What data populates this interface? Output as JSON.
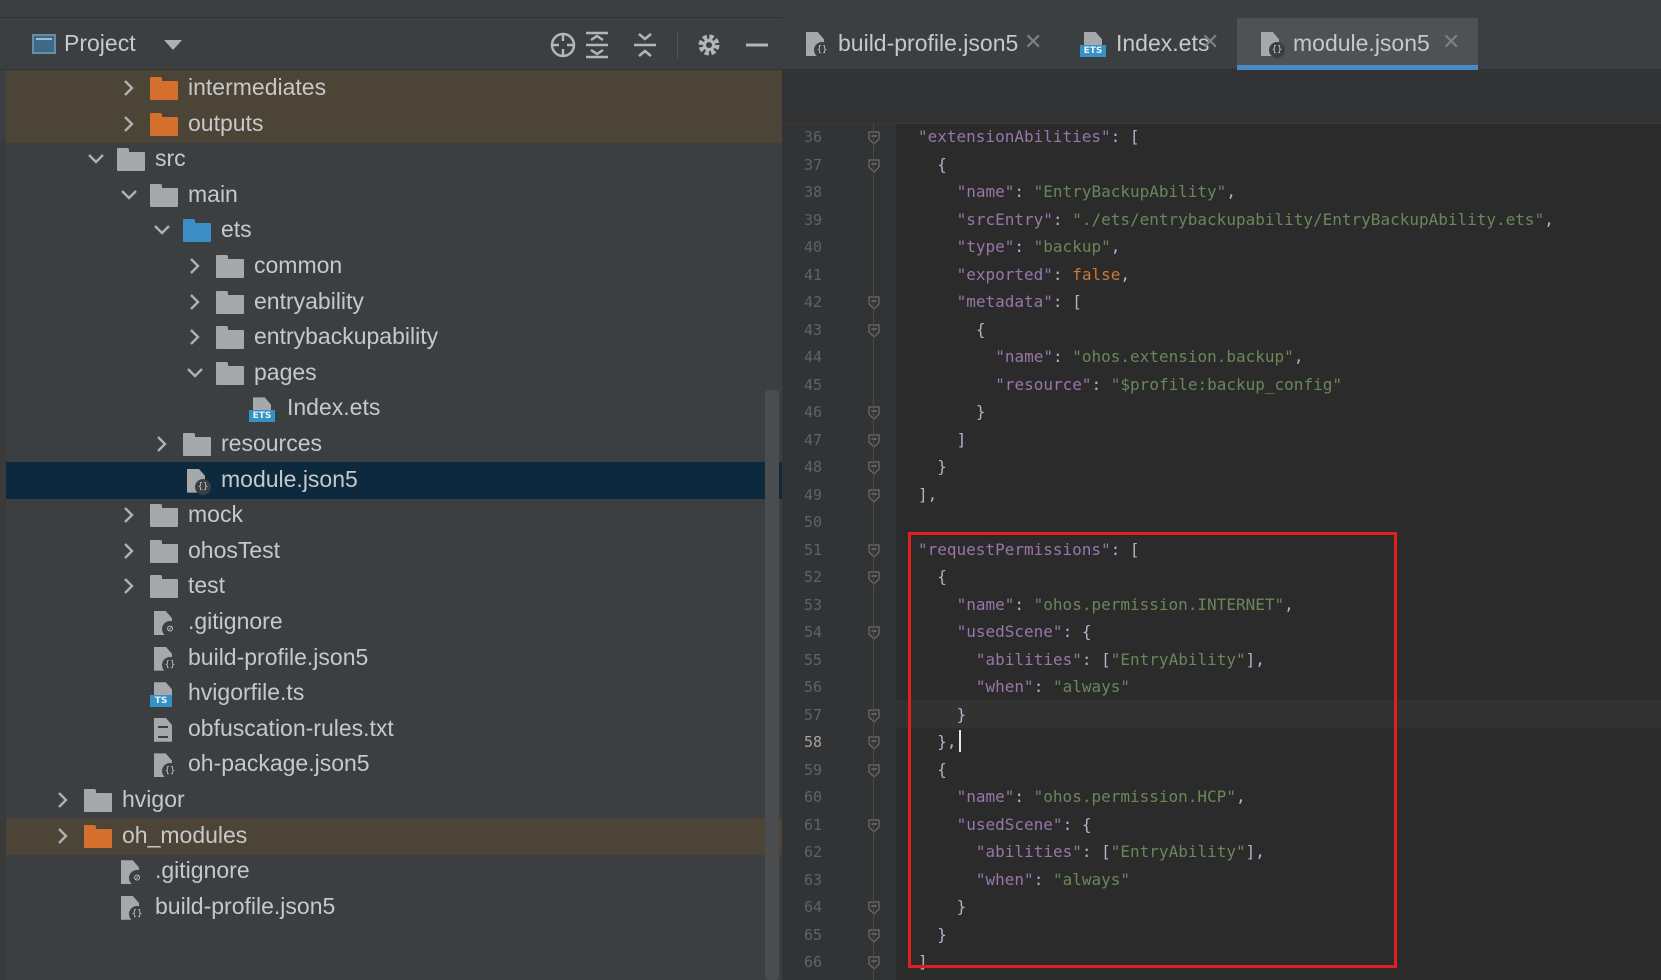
{
  "project_panel": {
    "title": "Project",
    "toolbar": {
      "locate_icon": "crosshair-icon",
      "expand_all_icon": "expand-all-icon",
      "collapse_all_icon": "collapse-all-icon",
      "settings_icon": "gear-icon",
      "hide_icon": "minimize-icon"
    },
    "tree": [
      {
        "label": "intermediates",
        "type": "folder-orange",
        "level": 2,
        "expanded": false
      },
      {
        "label": "outputs",
        "type": "folder-orange",
        "level": 2,
        "expanded": false
      },
      {
        "label": "src",
        "type": "folder",
        "level": 1,
        "expanded": true
      },
      {
        "label": "main",
        "type": "folder",
        "level": 2,
        "expanded": true
      },
      {
        "label": "ets",
        "type": "folder-blue",
        "level": 3,
        "expanded": true
      },
      {
        "label": "common",
        "type": "folder",
        "level": 4,
        "expanded": false
      },
      {
        "label": "entryability",
        "type": "folder",
        "level": 4,
        "expanded": false
      },
      {
        "label": "entrybackupability",
        "type": "folder",
        "level": 4,
        "expanded": false
      },
      {
        "label": "pages",
        "type": "folder",
        "level": 4,
        "expanded": true
      },
      {
        "label": "Index.ets",
        "type": "file-ets",
        "level": 5
      },
      {
        "label": "resources",
        "type": "folder",
        "level": 3,
        "expanded": false
      },
      {
        "label": "module.json5",
        "type": "file-json5",
        "level": 3,
        "selected": true
      },
      {
        "label": "mock",
        "type": "folder",
        "level": 2,
        "expanded": false
      },
      {
        "label": "ohosTest",
        "type": "folder",
        "level": 2,
        "expanded": false
      },
      {
        "label": "test",
        "type": "folder",
        "level": 2,
        "expanded": false
      },
      {
        "label": ".gitignore",
        "type": "file-ignore",
        "level": 2
      },
      {
        "label": "build-profile.json5",
        "type": "file-json5",
        "level": 2
      },
      {
        "label": "hvigorfile.ts",
        "type": "file-ts",
        "level": 2
      },
      {
        "label": "obfuscation-rules.txt",
        "type": "file-txt",
        "level": 2
      },
      {
        "label": "oh-package.json5",
        "type": "file-json5",
        "level": 2
      },
      {
        "label": "hvigor",
        "type": "folder",
        "level": 0,
        "expanded": false
      },
      {
        "label": "oh_modules",
        "type": "folder-orange",
        "level": 0,
        "expanded": false
      },
      {
        "label": ".gitignore",
        "type": "file-ignore",
        "level": 1
      },
      {
        "label": "build-profile.json5",
        "type": "file-json5",
        "level": 1
      }
    ]
  },
  "editor": {
    "tabs": [
      {
        "label": "build-profile.json5",
        "icon": "json5-file-icon",
        "active": false
      },
      {
        "label": "Index.ets",
        "icon": "ets-file-icon",
        "active": false
      },
      {
        "label": "module.json5",
        "icon": "json5-file-icon",
        "active": true
      }
    ],
    "current_line": 58,
    "lines": [
      {
        "n": "36",
        "indent": 0,
        "fold": true,
        "tokens": [
          [
            "key",
            "\"extensionAbilities\""
          ],
          [
            "p",
            ": ["
          ]
        ]
      },
      {
        "n": "37",
        "indent": 1,
        "fold": true,
        "tokens": [
          [
            "p",
            "{"
          ]
        ]
      },
      {
        "n": "38",
        "indent": 2,
        "fold": false,
        "tokens": [
          [
            "key",
            "\"name\""
          ],
          [
            "p",
            ": "
          ],
          [
            "str",
            "\"EntryBackupAbility\""
          ],
          [
            "p",
            ","
          ]
        ]
      },
      {
        "n": "39",
        "indent": 2,
        "fold": false,
        "tokens": [
          [
            "key",
            "\"srcEntry\""
          ],
          [
            "p",
            ": "
          ],
          [
            "str",
            "\"./ets/entrybackupability/EntryBackupAbility.ets\""
          ],
          [
            "p",
            ","
          ]
        ]
      },
      {
        "n": "40",
        "indent": 2,
        "fold": false,
        "tokens": [
          [
            "key",
            "\"type\""
          ],
          [
            "p",
            ": "
          ],
          [
            "str",
            "\"backup\""
          ],
          [
            "p",
            ","
          ]
        ]
      },
      {
        "n": "41",
        "indent": 2,
        "fold": false,
        "tokens": [
          [
            "key",
            "\"exported\""
          ],
          [
            "p",
            ": "
          ],
          [
            "kw",
            "false"
          ],
          [
            "p",
            ","
          ]
        ]
      },
      {
        "n": "42",
        "indent": 2,
        "fold": true,
        "tokens": [
          [
            "key",
            "\"metadata\""
          ],
          [
            "p",
            ": ["
          ]
        ]
      },
      {
        "n": "43",
        "indent": 3,
        "fold": true,
        "tokens": [
          [
            "p",
            "{"
          ]
        ]
      },
      {
        "n": "44",
        "indent": 4,
        "fold": false,
        "tokens": [
          [
            "key",
            "\"name\""
          ],
          [
            "p",
            ": "
          ],
          [
            "str",
            "\"ohos.extension.backup\""
          ],
          [
            "p",
            ","
          ]
        ]
      },
      {
        "n": "45",
        "indent": 4,
        "fold": false,
        "tokens": [
          [
            "key",
            "\"resource\""
          ],
          [
            "p",
            ": "
          ],
          [
            "str",
            "\"$profile:backup_config\""
          ]
        ]
      },
      {
        "n": "46",
        "indent": 3,
        "fold": true,
        "tokens": [
          [
            "p",
            "}"
          ]
        ]
      },
      {
        "n": "47",
        "indent": 2,
        "fold": true,
        "tokens": [
          [
            "p",
            "]"
          ]
        ]
      },
      {
        "n": "48",
        "indent": 1,
        "fold": true,
        "tokens": [
          [
            "p",
            "}"
          ]
        ]
      },
      {
        "n": "49",
        "indent": 0,
        "fold": true,
        "tokens": [
          [
            "p",
            "],"
          ]
        ]
      },
      {
        "n": "50",
        "indent": 0,
        "fold": false,
        "tokens": []
      },
      {
        "n": "51",
        "indent": 0,
        "fold": true,
        "tokens": [
          [
            "key",
            "\"requestPermissions\""
          ],
          [
            "p",
            ": ["
          ]
        ]
      },
      {
        "n": "52",
        "indent": 1,
        "fold": true,
        "tokens": [
          [
            "p",
            "{"
          ]
        ]
      },
      {
        "n": "53",
        "indent": 2,
        "fold": false,
        "tokens": [
          [
            "key",
            "\"name\""
          ],
          [
            "p",
            ": "
          ],
          [
            "str",
            "\"ohos.permission.INTERNET\""
          ],
          [
            "p",
            ","
          ]
        ]
      },
      {
        "n": "54",
        "indent": 2,
        "fold": true,
        "tokens": [
          [
            "key",
            "\"usedScene\""
          ],
          [
            "p",
            ": {"
          ]
        ]
      },
      {
        "n": "55",
        "indent": 3,
        "fold": false,
        "tokens": [
          [
            "key",
            "\"abilities\""
          ],
          [
            "p",
            ": ["
          ],
          [
            "str",
            "\"EntryAbility\""
          ],
          [
            "p",
            "],"
          ]
        ]
      },
      {
        "n": "56",
        "indent": 3,
        "fold": false,
        "tokens": [
          [
            "key",
            "\"when\""
          ],
          [
            "p",
            ": "
          ],
          [
            "str",
            "\"always\""
          ]
        ]
      },
      {
        "n": "57",
        "indent": 2,
        "fold": true,
        "tokens": [
          [
            "p",
            "}"
          ]
        ]
      },
      {
        "n": "58",
        "indent": 1,
        "fold": true,
        "tokens": [
          [
            "p",
            "},"
          ]
        ]
      },
      {
        "n": "59",
        "indent": 1,
        "fold": true,
        "tokens": [
          [
            "p",
            "{"
          ]
        ]
      },
      {
        "n": "60",
        "indent": 2,
        "fold": false,
        "tokens": [
          [
            "key",
            "\"name\""
          ],
          [
            "p",
            ": "
          ],
          [
            "str",
            "\"ohos.permission.HCP\""
          ],
          [
            "p",
            ","
          ]
        ]
      },
      {
        "n": "61",
        "indent": 2,
        "fold": true,
        "tokens": [
          [
            "key",
            "\"usedScene\""
          ],
          [
            "p",
            ": {"
          ]
        ]
      },
      {
        "n": "62",
        "indent": 3,
        "fold": false,
        "tokens": [
          [
            "key",
            "\"abilities\""
          ],
          [
            "p",
            ": ["
          ],
          [
            "str",
            "\"EntryAbility\""
          ],
          [
            "p",
            "],"
          ]
        ]
      },
      {
        "n": "63",
        "indent": 3,
        "fold": false,
        "tokens": [
          [
            "key",
            "\"when\""
          ],
          [
            "p",
            ": "
          ],
          [
            "str",
            "\"always\""
          ]
        ]
      },
      {
        "n": "64",
        "indent": 2,
        "fold": true,
        "tokens": [
          [
            "p",
            "}"
          ]
        ]
      },
      {
        "n": "65",
        "indent": 1,
        "fold": true,
        "tokens": [
          [
            "p",
            "}"
          ]
        ]
      },
      {
        "n": "66",
        "indent": 0,
        "fold": true,
        "tokens": [
          [
            "p",
            "]"
          ]
        ]
      }
    ]
  },
  "colors": {
    "key": "#9876aa",
    "string": "#6a8759",
    "keyword": "#cc7832",
    "punct": "#a9b7c6",
    "highlight_box": "#e02020",
    "selection": "#0d293e",
    "accent": "#4a88c7"
  }
}
